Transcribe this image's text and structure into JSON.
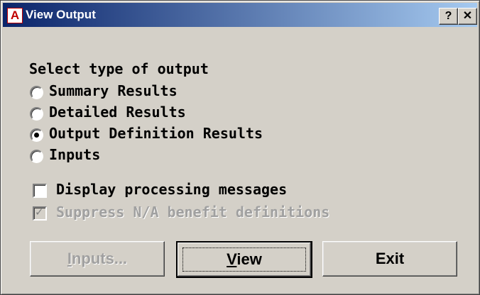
{
  "window": {
    "title": "View Output",
    "icon_glyph": "A",
    "help_glyph": "?",
    "close_glyph": "✕"
  },
  "output_group": {
    "label": "Select type of output",
    "options": [
      {
        "label": "Summary Results",
        "selected": false
      },
      {
        "label": "Detailed Results",
        "selected": false
      },
      {
        "label": "Output Definition Results",
        "selected": true
      },
      {
        "label": "Inputs",
        "selected": false
      }
    ]
  },
  "checks": [
    {
      "label": "Display processing messages",
      "checked": false,
      "enabled": true
    },
    {
      "label": "Suppress N/A benefit definitions",
      "checked": true,
      "enabled": false
    }
  ],
  "buttons": {
    "inputs": {
      "mnemonic": "I",
      "rest": "nputs...",
      "enabled": false
    },
    "view": {
      "mnemonic": "V",
      "rest": "iew",
      "default": true
    },
    "exit": {
      "label": "Exit"
    }
  },
  "colors": {
    "titlebar_start": "#0a246a",
    "titlebar_end": "#a6caf0",
    "face": "#d4d0c8"
  }
}
